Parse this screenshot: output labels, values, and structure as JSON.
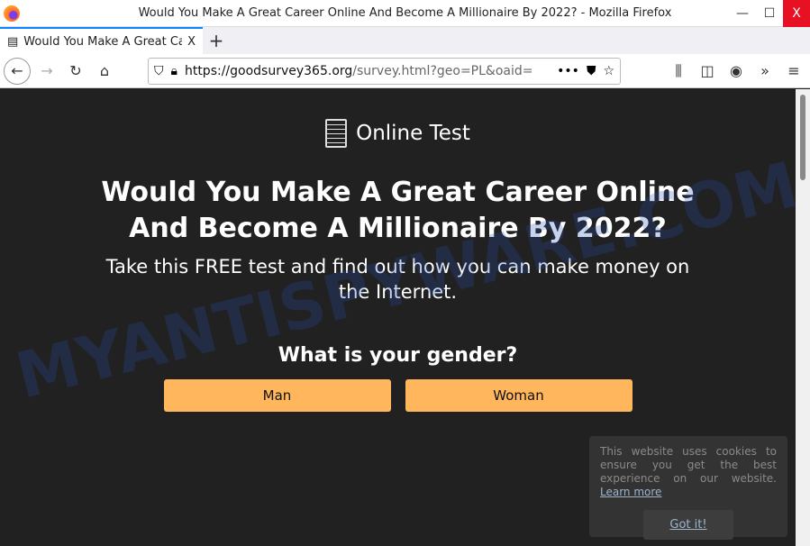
{
  "window": {
    "title": "Would You Make A Great Career Online And Become A Millionaire By 2022? - Mozilla Firefox",
    "min": "—",
    "max": "☐",
    "close": "X"
  },
  "tab": {
    "label": "Would You Make A Great Career Online And Become A Millionaire By 2022?",
    "close": "X",
    "new": "+"
  },
  "nav": {
    "url_host": "https://goodsurvey365.org",
    "url_path": "/survey.html?geo=PL&oaid=",
    "more": "•••"
  },
  "page": {
    "brand": "Online Test",
    "headline": "Would You Make A Great Career Online And Become A Millionaire By 2022?",
    "subtitle": "Take this FREE test and find out how you can make money on the Internet.",
    "question": "What is your gender?",
    "options": [
      "Man",
      "Woman"
    ],
    "button_color": "#ffb65c"
  },
  "cookie": {
    "text": "This website uses cookies to ensure you get the best experience on our website.",
    "link": "Learn more",
    "button": "Got it!"
  },
  "watermark": "MYANTISPYWARE.COM"
}
